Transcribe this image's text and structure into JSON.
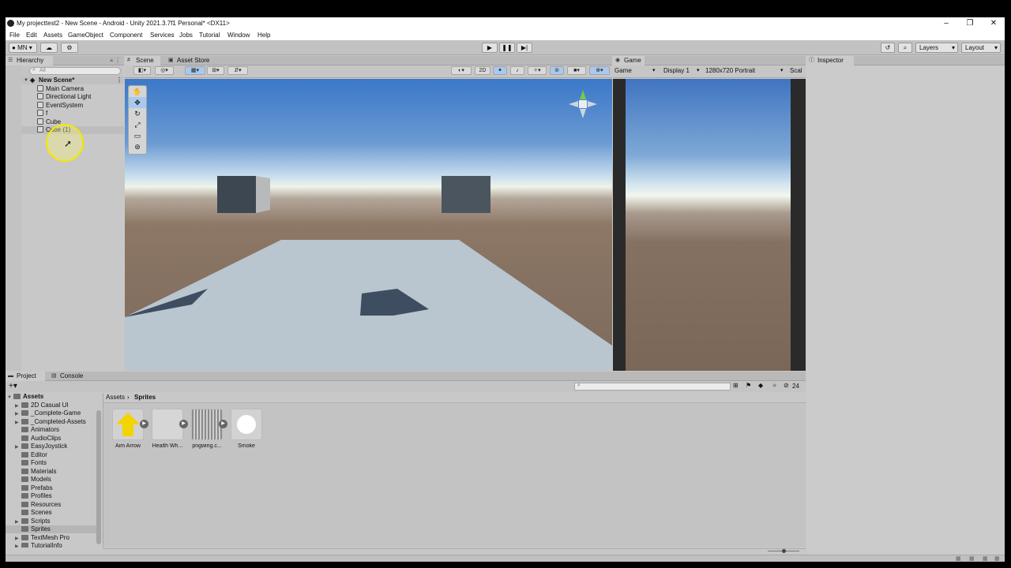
{
  "window": {
    "title": "My projecttest2 - New Scene - Android - Unity 2021.3.7f1 Personal* <DX11>"
  },
  "menu": [
    "File",
    "Edit",
    "Assets",
    "GameObject",
    "Component",
    "Services",
    "Jobs",
    "Tutorial",
    "Window",
    "Help"
  ],
  "toolbar": {
    "account": "MN",
    "layers": "Layers",
    "layout": "Layout"
  },
  "hierarchy": {
    "tab": "Hierarchy",
    "search_placeholder": "All",
    "scene": "New Scene*",
    "items": [
      "Main Camera",
      "Directional Light",
      "EventSystem",
      "f",
      "Cube",
      "Cube (1)"
    ]
  },
  "scene_view": {
    "tabs": [
      "Scene",
      "Asset Store"
    ],
    "mode_2d": "2D"
  },
  "game_view": {
    "tab": "Game",
    "display_label": "Game",
    "display": "Display 1",
    "resolution": "1280x720 Portrait",
    "scale": "Scal"
  },
  "inspector": {
    "tab": "Inspector"
  },
  "project": {
    "tabs": [
      "Project",
      "Console"
    ],
    "root": "Assets",
    "folders": [
      "2D Casual UI",
      "_Complete-Game",
      "_Completed-Assets",
      "Animators",
      "AudioClips",
      "EasyJoystick",
      "Editor",
      "Fonts",
      "Materials",
      "Models",
      "Prefabs",
      "Profiles",
      "Resources",
      "Scenes",
      "Scripts",
      "Sprites",
      "TextMesh Pro",
      "TutorialInfo"
    ],
    "breadcrumb": [
      "Assets",
      "Sprites"
    ],
    "assets": [
      "Aim Arrow",
      "Health Wh...",
      "pngwing.c...",
      "Smoke"
    ],
    "count": "24"
  },
  "colors": {
    "panel": "#c8c8c8",
    "selection": "#b4b4b4",
    "accent_blue": "#3a86d6",
    "arrow_yellow": "#f2d400"
  }
}
